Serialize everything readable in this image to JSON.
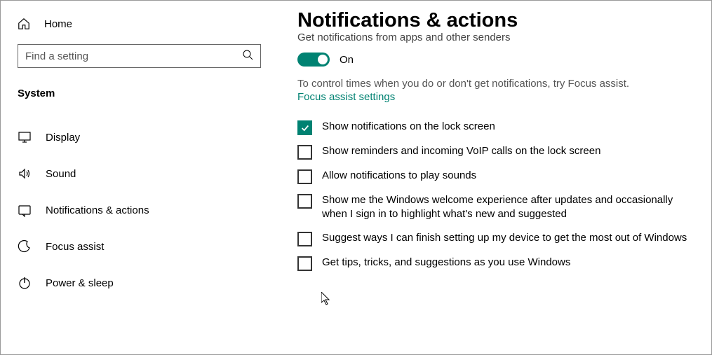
{
  "sidebar": {
    "home_label": "Home",
    "search_placeholder": "Find a setting",
    "category_label": "System",
    "items": [
      {
        "label": "Display",
        "icon": "display-icon"
      },
      {
        "label": "Sound",
        "icon": "sound-icon"
      },
      {
        "label": "Notifications & actions",
        "icon": "notifications-icon"
      },
      {
        "label": "Focus assist",
        "icon": "focus-assist-icon"
      },
      {
        "label": "Power & sleep",
        "icon": "power-icon"
      }
    ]
  },
  "content": {
    "title": "Notifications & actions",
    "subtitle": "Get notifications from apps and other senders",
    "toggle": {
      "state": "On"
    },
    "hint": "To control times when you do or don't get notifications, try Focus assist.",
    "link_label": "Focus assist settings",
    "checkboxes": [
      {
        "checked": true,
        "label": "Show notifications on the lock screen"
      },
      {
        "checked": false,
        "label": "Show reminders and incoming VoIP calls on the lock screen"
      },
      {
        "checked": false,
        "label": "Allow notifications to play sounds"
      },
      {
        "checked": false,
        "label": "Show me the Windows welcome experience after updates and occasionally when I sign in to highlight what's new and suggested"
      },
      {
        "checked": false,
        "label": "Suggest ways I can finish setting up my device to get the most out of Windows"
      },
      {
        "checked": false,
        "label": "Get tips, tricks, and suggestions as you use Windows"
      }
    ]
  }
}
